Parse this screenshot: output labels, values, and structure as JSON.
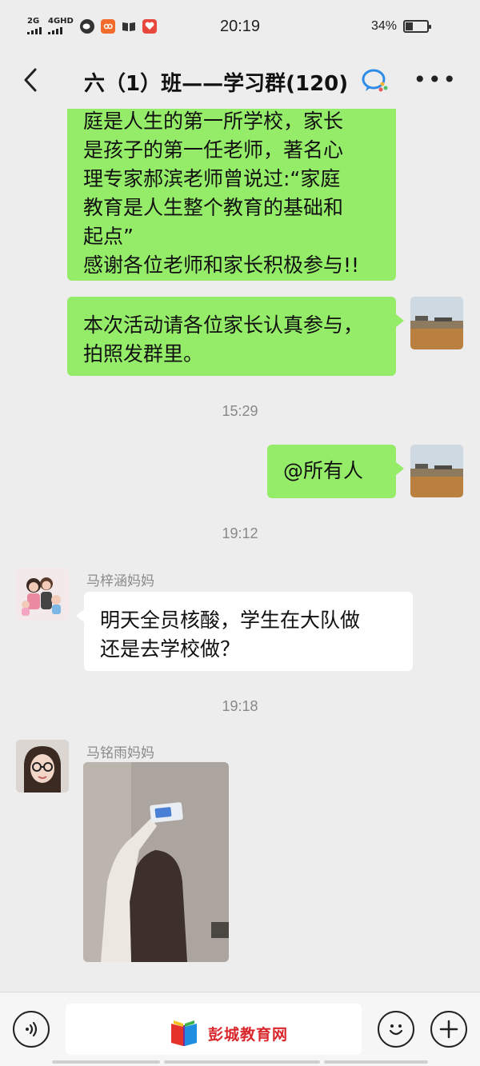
{
  "status_bar": {
    "net1": "2G",
    "net2": "4GHD",
    "time": "20:19",
    "battery_text": "34%",
    "battery_level": 0.34
  },
  "header": {
    "title": "六（1）班——学习群(120)",
    "back_icon": "chevron-left-icon",
    "more_icon": "more-dots-icon"
  },
  "messages": {
    "m1": {
      "lines": [
        "庭是人生的第一所学校，家长",
        "是孩子的第一任老师，著名心",
        "理专家郝滨老师曾说过:“家庭",
        "教育是人生整个教育的基础和",
        "起点”",
        "感谢各位老师和家长积极参与!!"
      ]
    },
    "m2": {
      "lines": [
        "本次活动请各位家长认真参与，",
        "拍照发群里。"
      ]
    },
    "t1": "15:29",
    "m3": {
      "lines": [
        "@所有人"
      ]
    },
    "t2": "19:12",
    "m4": {
      "sender": "马梓涵妈妈",
      "lines": [
        "明天全员核酸，学生在大队做",
        "还是去学校做？"
      ]
    },
    "t3": "19:18",
    "m5": {
      "sender": "马铭雨妈妈"
    }
  },
  "bottom_bar": {
    "voice_icon": "voice-icon",
    "emoji_icon": "emoji-icon",
    "plus_icon": "plus-icon",
    "watermark": "彭城教育网"
  },
  "colors": {
    "sent_bubble": "#95ec69",
    "received_bubble": "#ffffff",
    "background": "#ededed",
    "watermark": "#d9262b"
  }
}
